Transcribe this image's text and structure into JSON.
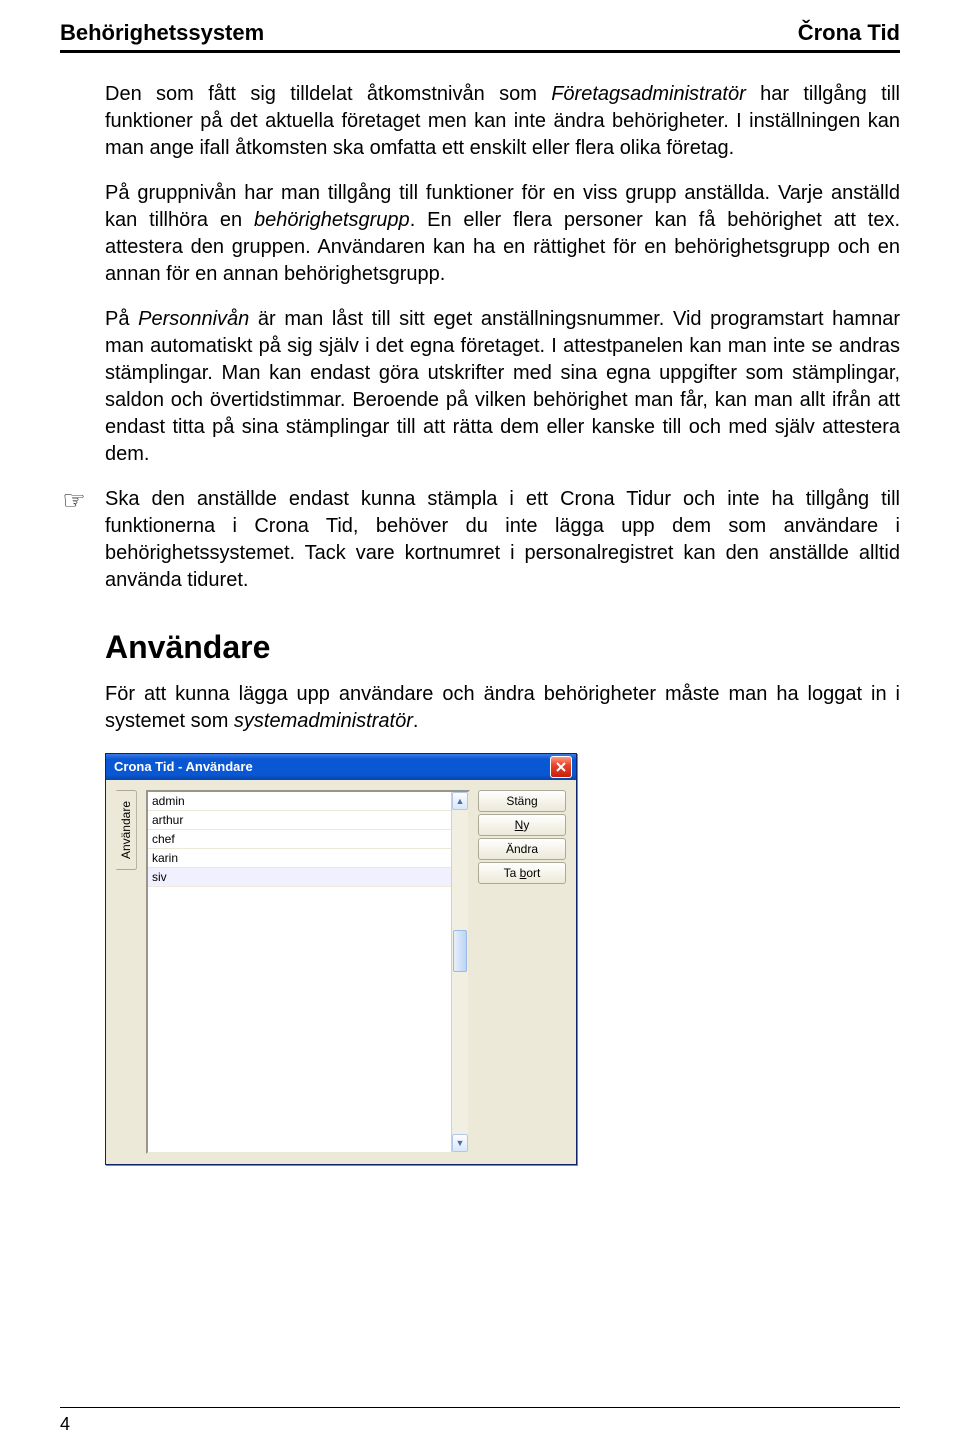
{
  "header": {
    "left": "Behörighetssystem",
    "right": "Črona Tid"
  },
  "paragraphs": {
    "p1_a": "Den som fått sig tilldelat åtkomstnivån som ",
    "p1_i": "Företagsadministratör",
    "p1_b": " har tillgång till funktioner på det aktuella företaget men kan inte ändra behörigheter. I inställningen kan man ange ifall åtkomsten ska omfatta ett enskilt eller flera olika företag.",
    "p2_a": "På gruppnivån har man tillgång till funktioner för en viss grupp anställda. Varje anställd kan tillhöra en ",
    "p2_i": "behörighetsgrupp",
    "p2_b": ". En eller flera personer kan få behörighet att tex. attestera den gruppen. Användaren kan ha en rättighet för en behörighetsgrupp och en annan för en annan behörighetsgrupp.",
    "p3_a": "På ",
    "p3_i": "Personnivån",
    "p3_b": " är man låst till sitt eget anställningsnummer. Vid programstart hamnar man automatiskt på sig själv i det egna företaget. I attestpanelen kan man inte se andras stämplingar. Man kan endast göra utskrifter med sina egna uppgifter som stämplingar, saldon och övertidstimmar. Beroende på vilken behörighet man får, kan man allt ifrån att endast titta på sina stämplingar till att rätta dem eller kanske till och med själv attestera dem.",
    "note": "Ska den anställde endast kunna stämpla i ett Crona Tidur och inte ha tillgång till funktionerna i Crona Tid, behöver du inte lägga upp dem som användare i behörighetssystemet. Tack vare kortnumret i personalregistret kan den anställde alltid använda tiduret."
  },
  "section": {
    "heading": "Användare",
    "intro_a": "För att kunna lägga upp användare och ändra behörigheter måste man ha loggat in i systemet som ",
    "intro_i": "systemadministratör",
    "intro_b": "."
  },
  "dialog": {
    "title": "Crona Tid - Användare",
    "tab": "Användare",
    "items": [
      "admin",
      "arthur",
      "chef",
      "karin",
      "siv"
    ],
    "selectedIndex": 4,
    "buttons": {
      "close": "Stäng",
      "new_pre": "",
      "new_u": "N",
      "new_post": "y",
      "edit": "Ändra",
      "delete_pre": "Ta ",
      "delete_u": "b",
      "delete_post": "ort"
    }
  },
  "footer": {
    "page": "4"
  },
  "icons": {
    "hand": "☞"
  }
}
